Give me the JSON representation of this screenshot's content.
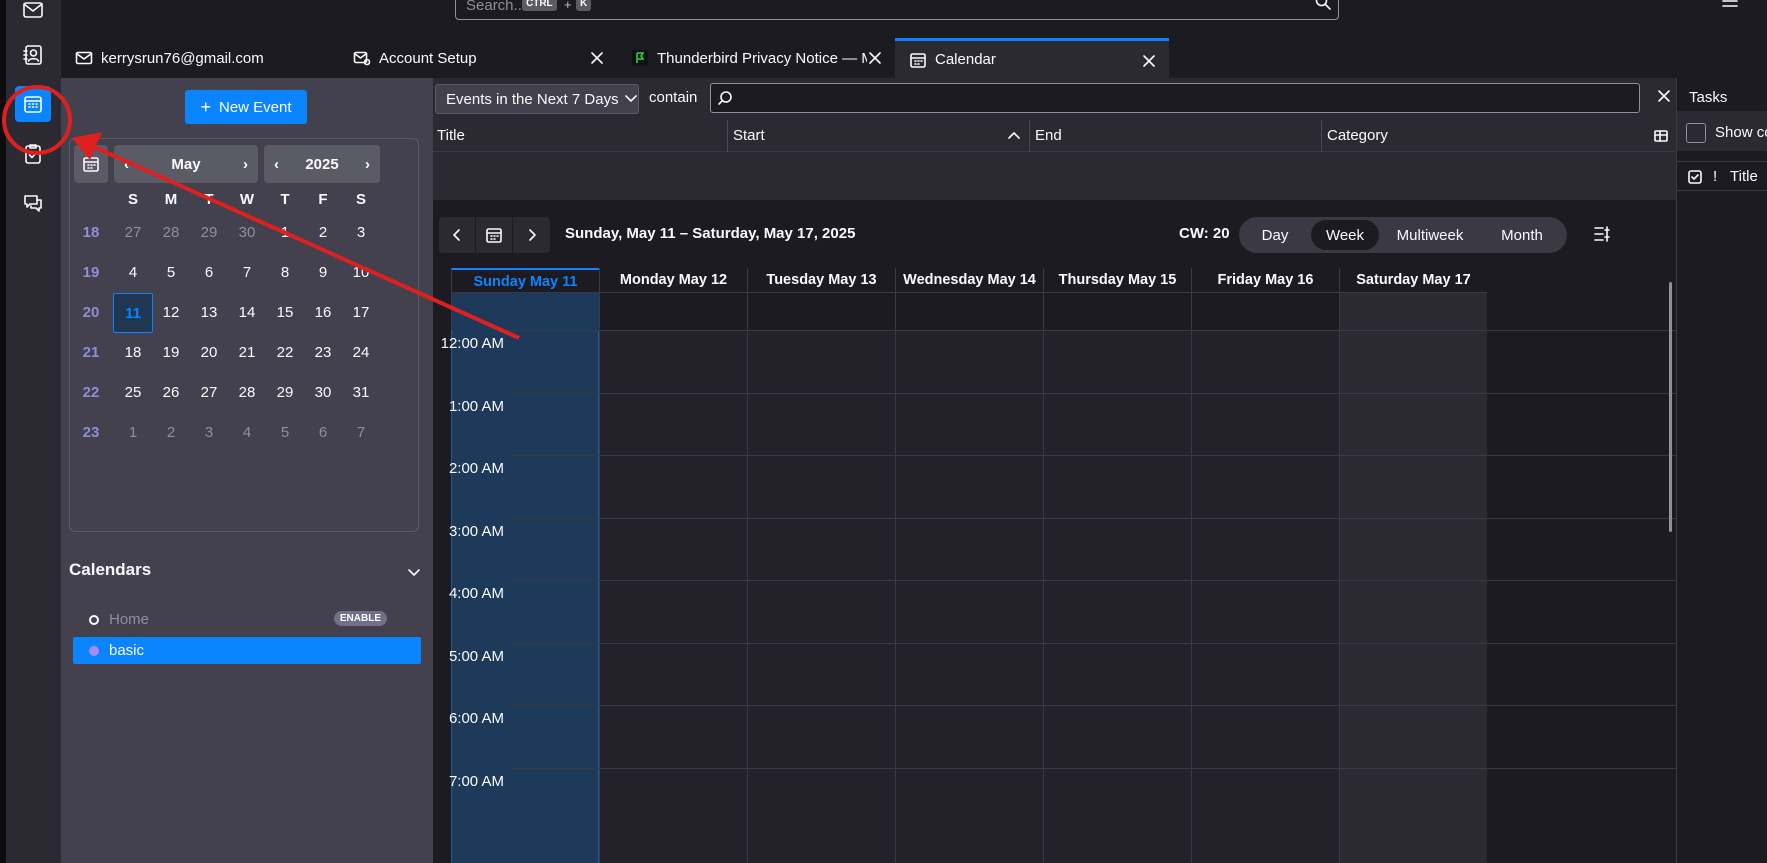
{
  "topbar": {
    "search_placeholder": "Search...",
    "kbd_ctrl": "CTRL",
    "kbd_plus": "+",
    "kbd_k": "K"
  },
  "tabs": [
    {
      "label": "kerrysrun76@gmail.com",
      "icon": "mail-icon"
    },
    {
      "label": "Account Setup",
      "icon": "mail-settings-icon"
    },
    {
      "label": "Thunderbird Privacy Notice — Mozi",
      "icon": "mozilla-icon"
    },
    {
      "label": "Calendar",
      "icon": "calendar-icon"
    }
  ],
  "today_pane": {
    "new_event": "New Event",
    "month": "May",
    "year": "2025",
    "dow": [
      "S",
      "M",
      "T",
      "W",
      "T",
      "F",
      "S"
    ],
    "weeks": [
      {
        "num": "18",
        "days": [
          "27",
          "28",
          "29",
          "30",
          "1",
          "2",
          "3"
        ]
      },
      {
        "num": "19",
        "days": [
          "4",
          "5",
          "6",
          "7",
          "8",
          "9",
          "10"
        ]
      },
      {
        "num": "20",
        "days": [
          "11",
          "12",
          "13",
          "14",
          "15",
          "16",
          "17"
        ]
      },
      {
        "num": "21",
        "days": [
          "18",
          "19",
          "20",
          "21",
          "22",
          "23",
          "24"
        ]
      },
      {
        "num": "22",
        "days": [
          "25",
          "26",
          "27",
          "28",
          "29",
          "30",
          "31"
        ]
      },
      {
        "num": "23",
        "days": [
          "1",
          "2",
          "3",
          "4",
          "5",
          "6",
          "7"
        ]
      }
    ],
    "calendars_header": "Calendars",
    "calendars": [
      {
        "name": "Home",
        "badge": "ENABLE",
        "color": "#fbfbfe"
      },
      {
        "name": "basic",
        "color": "#a78bfa"
      }
    ]
  },
  "filter": {
    "select": "Events in the Next 7 Days",
    "contain": "contain"
  },
  "list_columns": [
    "Title",
    "Start",
    "End",
    "Category"
  ],
  "week": {
    "range": "Sunday, May 11 – Saturday, May 17, 2025",
    "cw": "CW: 20",
    "views": [
      "Day",
      "Week",
      "Multiweek",
      "Month"
    ],
    "days": [
      "Sunday May 11",
      "Monday May 12",
      "Tuesday May 13",
      "Wednesday May 14",
      "Thursday May 15",
      "Friday May 16",
      "Saturday May 17"
    ],
    "hours": [
      "12:00 AM",
      "1:00 AM",
      "2:00 AM",
      "3:00 AM",
      "4:00 AM",
      "5:00 AM",
      "6:00 AM",
      "7:00 AM"
    ]
  },
  "tasks": {
    "title": "Tasks",
    "show_completed": "Show co",
    "col_priority": "!",
    "col_title": "Title"
  },
  "colors": {
    "accent": "#0a84ff",
    "annotation": "#e02020"
  }
}
